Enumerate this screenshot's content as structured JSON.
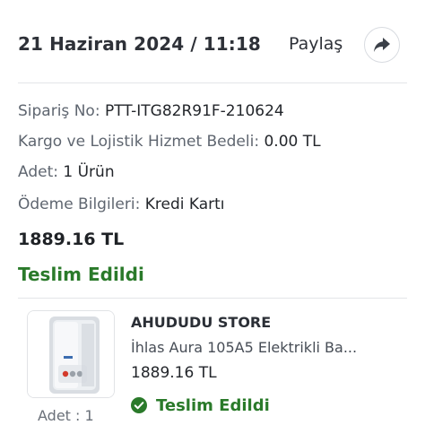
{
  "header": {
    "date": "21 Haziran 2024 / 11:18",
    "share_label": "Paylaş"
  },
  "order": {
    "order_no_label": "Sipariş No:",
    "order_no_value": "PTT-ITG82R91F-210624",
    "shipping_label": "Kargo ve Lojistik Hizmet Bedeli:",
    "shipping_value": "0.00 TL",
    "quantity_label": "Adet:",
    "quantity_value": "1 Ürün",
    "payment_label": "Ödeme Bilgileri:",
    "payment_value": "Kredi Kartı",
    "total": "1889.16 TL",
    "status": "Teslim Edildi"
  },
  "item": {
    "store": "AHUDUDU STORE",
    "name": "İhlas Aura 105A5 Elektrikli Ba...",
    "price": "1889.16 TL",
    "status": "Teslim Edildi",
    "quantity": "Adet : 1"
  },
  "colors": {
    "status_green": "#2a7a2a",
    "text_dark": "#2e3138",
    "text_label": "#5f6670",
    "divider": "#e3e5e8"
  },
  "icons": {
    "share": "share-arrow-icon",
    "check": "check-circle-icon"
  }
}
